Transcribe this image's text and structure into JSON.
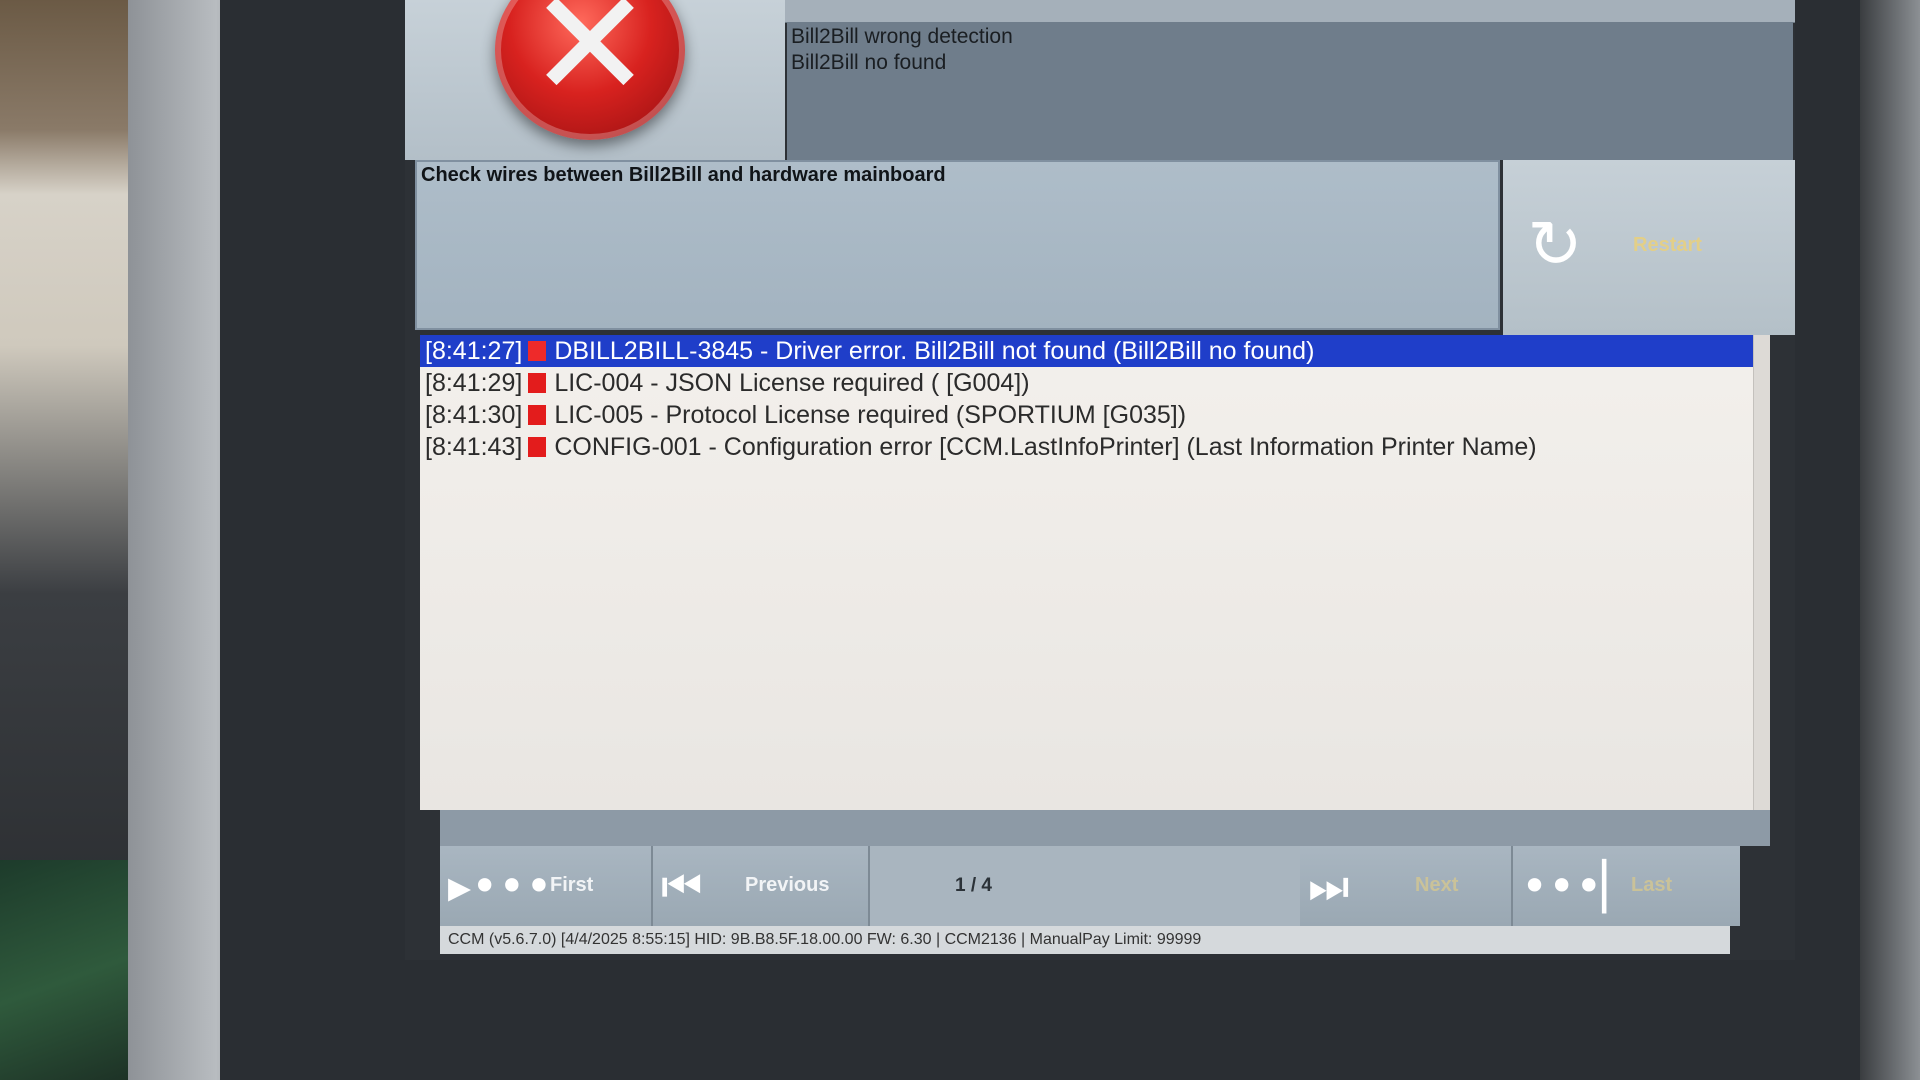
{
  "error_panel": {
    "messages": [
      "Bill2Bill wrong detection",
      "Bill2Bill no found"
    ],
    "hint": "Check wires between Bill2Bill and hardware mainboard",
    "restart_label": "Restart"
  },
  "log": {
    "entries": [
      {
        "time": "[8:41:27]",
        "text": "DBILL2BILL-3845 - Driver error. Bill2Bill not found (Bill2Bill no found)",
        "selected": true
      },
      {
        "time": "[8:41:29]",
        "text": "LIC-004 - JSON License required ( [G004])",
        "selected": false
      },
      {
        "time": "[8:41:30]",
        "text": "LIC-005 - Protocol License required (SPORTIUM [G035])",
        "selected": false
      },
      {
        "time": "[8:41:43]",
        "text": "CONFIG-001 - Configuration error [CCM.LastInfoPrinter] (Last Information Printer Name)",
        "selected": false
      }
    ],
    "severity_color": "#e31c1c",
    "selected_color": "#1f3ec9"
  },
  "nav": {
    "first": "First",
    "previous": "Previous",
    "page": "1 / 4",
    "next": "Next",
    "last": "Last"
  },
  "status_bar": "CCM (v5.6.7.0) [4/4/2025 8:55:15] HID: 9B.B8.5F.18.00.00 FW: 6.30 | CCM2136 | ManualPay Limit: 99999",
  "icons": {
    "error": "error-x-icon",
    "restart": "restart-icon",
    "first": "skip-first-icon",
    "previous": "step-back-icon",
    "next": "step-forward-icon",
    "last": "skip-last-icon"
  }
}
